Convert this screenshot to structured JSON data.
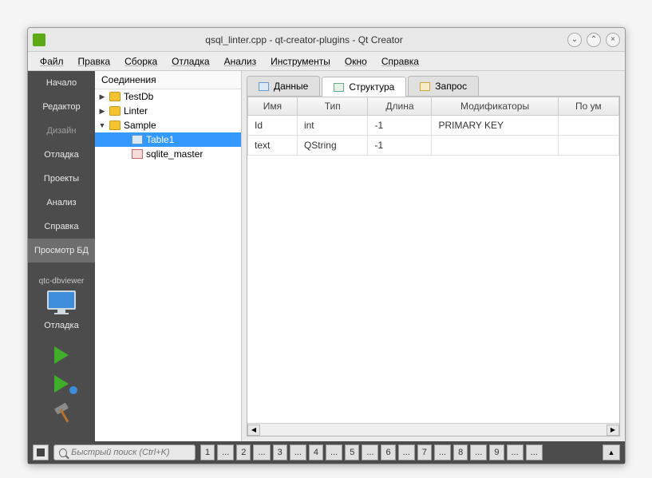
{
  "window": {
    "title": "qsql_linter.cpp - qt-creator-plugins - Qt Creator"
  },
  "menu": [
    "Файл",
    "Правка",
    "Сборка",
    "Отладка",
    "Анализ",
    "Инструменты",
    "Окно",
    "Справка"
  ],
  "sidebar": {
    "items": [
      {
        "label": "Начало",
        "dim": false
      },
      {
        "label": "Редактор",
        "dim": false
      },
      {
        "label": "Дизайн",
        "dim": true
      },
      {
        "label": "Отладка",
        "dim": false
      },
      {
        "label": "Проекты",
        "dim": false
      },
      {
        "label": "Анализ",
        "dim": false
      },
      {
        "label": "Справка",
        "dim": false
      },
      {
        "label": "Просмотр БД",
        "dim": false,
        "active": true
      }
    ],
    "kit": "qtc-dbviewer",
    "debug_label": "Отладка"
  },
  "tree": {
    "header": "Соединения",
    "nodes": [
      {
        "label": "TestDb",
        "expanded": false,
        "type": "db",
        "depth": 0
      },
      {
        "label": "Linter",
        "expanded": false,
        "type": "db",
        "depth": 0
      },
      {
        "label": "Sample",
        "expanded": true,
        "type": "db",
        "depth": 0
      },
      {
        "label": "Table1",
        "type": "table-blue",
        "depth": 1,
        "selected": true
      },
      {
        "label": "sqlite_master",
        "type": "table-red",
        "depth": 1
      }
    ]
  },
  "tabs": [
    {
      "label": "Данные",
      "icon": "blue"
    },
    {
      "label": "Структура",
      "icon": "green",
      "active": true
    },
    {
      "label": "Запрос",
      "icon": "yel"
    }
  ],
  "table": {
    "headers": [
      "Имя",
      "Тип",
      "Длина",
      "Модификаторы",
      "По ум"
    ],
    "rows": [
      {
        "name": "Id",
        "type": "int",
        "len": "-1",
        "mod": "PRIMARY KEY",
        "def": ""
      },
      {
        "name": "text",
        "type": "QString",
        "len": "-1",
        "mod": "",
        "def": ""
      }
    ]
  },
  "bottom": {
    "search_placeholder": "Быстрый поиск (Ctrl+K)",
    "locators": [
      "1",
      "...",
      "2",
      "...",
      "3",
      "...",
      "4",
      "...",
      "5",
      "...",
      "6",
      "...",
      "7",
      "...",
      "8",
      "...",
      "9",
      "...",
      "..."
    ]
  }
}
